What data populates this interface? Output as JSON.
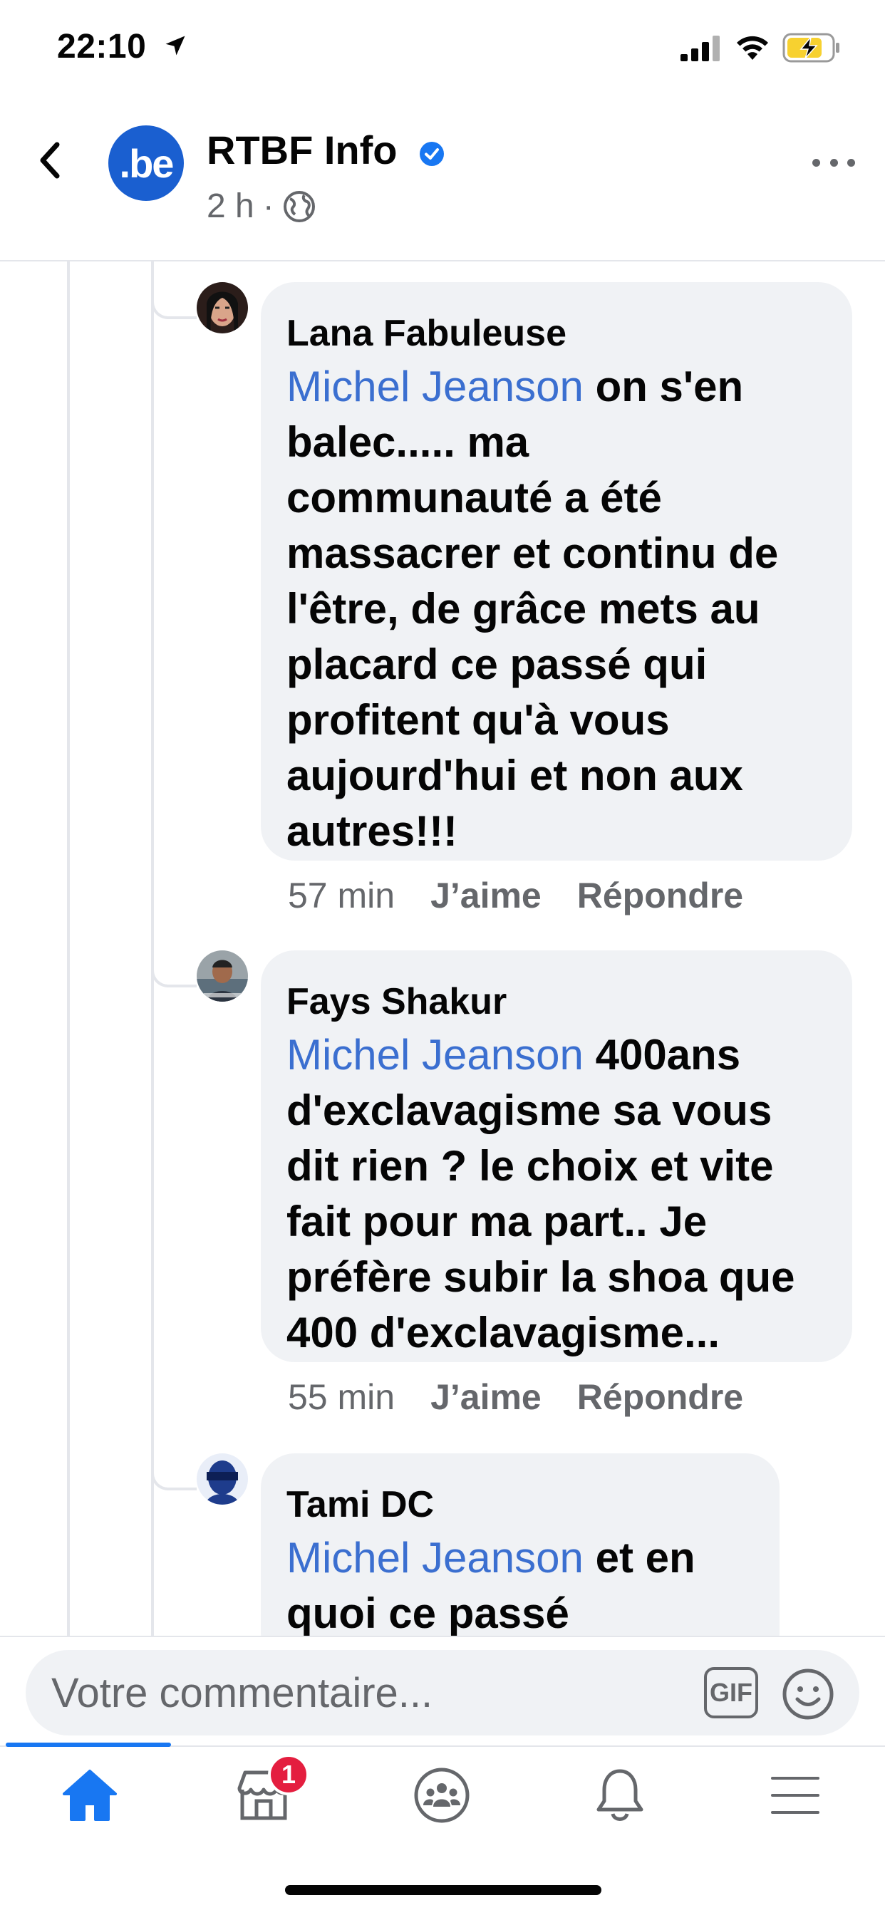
{
  "status_bar": {
    "time": "22:10",
    "icons": [
      "location-arrow-icon",
      "cellular-signal-icon",
      "wifi-icon",
      "battery-charging-icon"
    ]
  },
  "header": {
    "avatar_text": ".be",
    "page_name": "RTBF Info",
    "post_time": "2 h",
    "separator": "·",
    "verified": true
  },
  "comments": [
    {
      "author": "Lana Fabuleuse",
      "mention": "Michel Jeanson",
      "text_lines": [
        " on s'en",
        "balec..... ma",
        "communauté a  été",
        "massacrer  et continu de",
        "l'être,   de grâce  mets au",
        "placard  ce passé  qui",
        "profitent  qu'à vous",
        "aujourd'hui  et non aux",
        "autres!!!"
      ],
      "time": "57 min",
      "like_label": "J’aime",
      "reply_label": "Répondre"
    },
    {
      "author": "Fays Shakur",
      "mention": "Michel Jeanson",
      "text_lines": [
        " 400ans",
        "d'exclavagisme sa vous",
        "dit rien ? le choix et vite",
        "fait pour ma part.. Je",
        "préfère subir la shoa que",
        "400 d'exclavagisme..."
      ],
      "time": "55 min",
      "like_label": "J’aime",
      "reply_label": "Répondre"
    },
    {
      "author": "Tami DC",
      "mention": "Michel Jeanson",
      "text_lines": [
        " et en",
        "quoi ce passé"
      ]
    }
  ],
  "composer": {
    "placeholder": "Votre commentaire...",
    "gif_label": "GIF"
  },
  "tabbar": {
    "tabs": [
      "home",
      "marketplace",
      "groups",
      "notifications",
      "menu"
    ],
    "active_tab": "home",
    "marketplace_badge": "1"
  },
  "colors": {
    "mention": "#3b6fd0",
    "accent": "#1877f2",
    "badge": "#e41e3f",
    "bubble": "#f0f2f5"
  }
}
